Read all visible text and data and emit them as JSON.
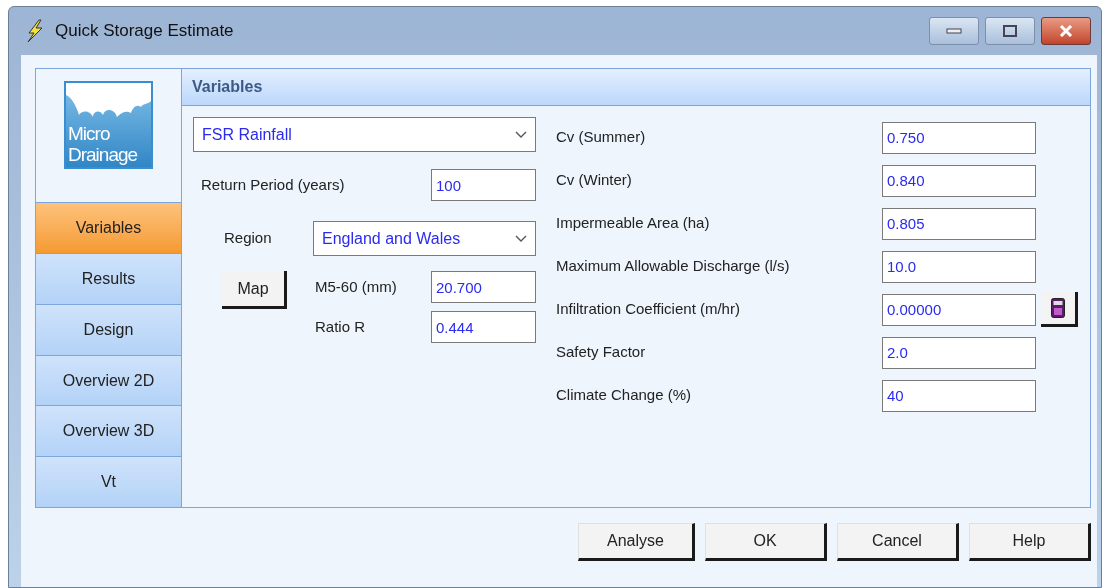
{
  "window": {
    "title": "Quick Storage Estimate"
  },
  "logo": {
    "lines": [
      "Micro",
      "Drainage"
    ]
  },
  "sidebar": {
    "items": [
      {
        "label": "Variables",
        "selected": true
      },
      {
        "label": "Results",
        "selected": false
      },
      {
        "label": "Design",
        "selected": false
      },
      {
        "label": "Overview 2D",
        "selected": false
      },
      {
        "label": "Overview 3D",
        "selected": false
      },
      {
        "label": "Vt",
        "selected": false
      }
    ]
  },
  "panel": {
    "title": "Variables"
  },
  "rainfall": {
    "value": "FSR Rainfall"
  },
  "return_period": {
    "label": "Return Period (years)",
    "value": "100"
  },
  "region": {
    "label": "Region",
    "value": "England and Wales"
  },
  "map_button": "Map",
  "m5_60": {
    "label": "M5-60 (mm)",
    "value": "20.700"
  },
  "ratio_r": {
    "label": "Ratio R",
    "value": "0.444"
  },
  "parameters": [
    {
      "label": "Cv (Summer)",
      "value": "0.750",
      "calculator": false
    },
    {
      "label": "Cv (Winter)",
      "value": "0.840",
      "calculator": false
    },
    {
      "label": "Impermeable Area (ha)",
      "value": "0.805",
      "calculator": false
    },
    {
      "label": "Maximum Allowable Discharge (l/s)",
      "value": "10.0",
      "calculator": false
    },
    {
      "label": "Infiltration Coefficient (m/hr)",
      "value": "0.00000",
      "calculator": true
    },
    {
      "label": "Safety Factor",
      "value": "2.0",
      "calculator": false
    },
    {
      "label": "Climate Change (%)",
      "value": "40",
      "calculator": false
    }
  ],
  "buttons": [
    "Analyse",
    "OK",
    "Cancel",
    "Help"
  ]
}
